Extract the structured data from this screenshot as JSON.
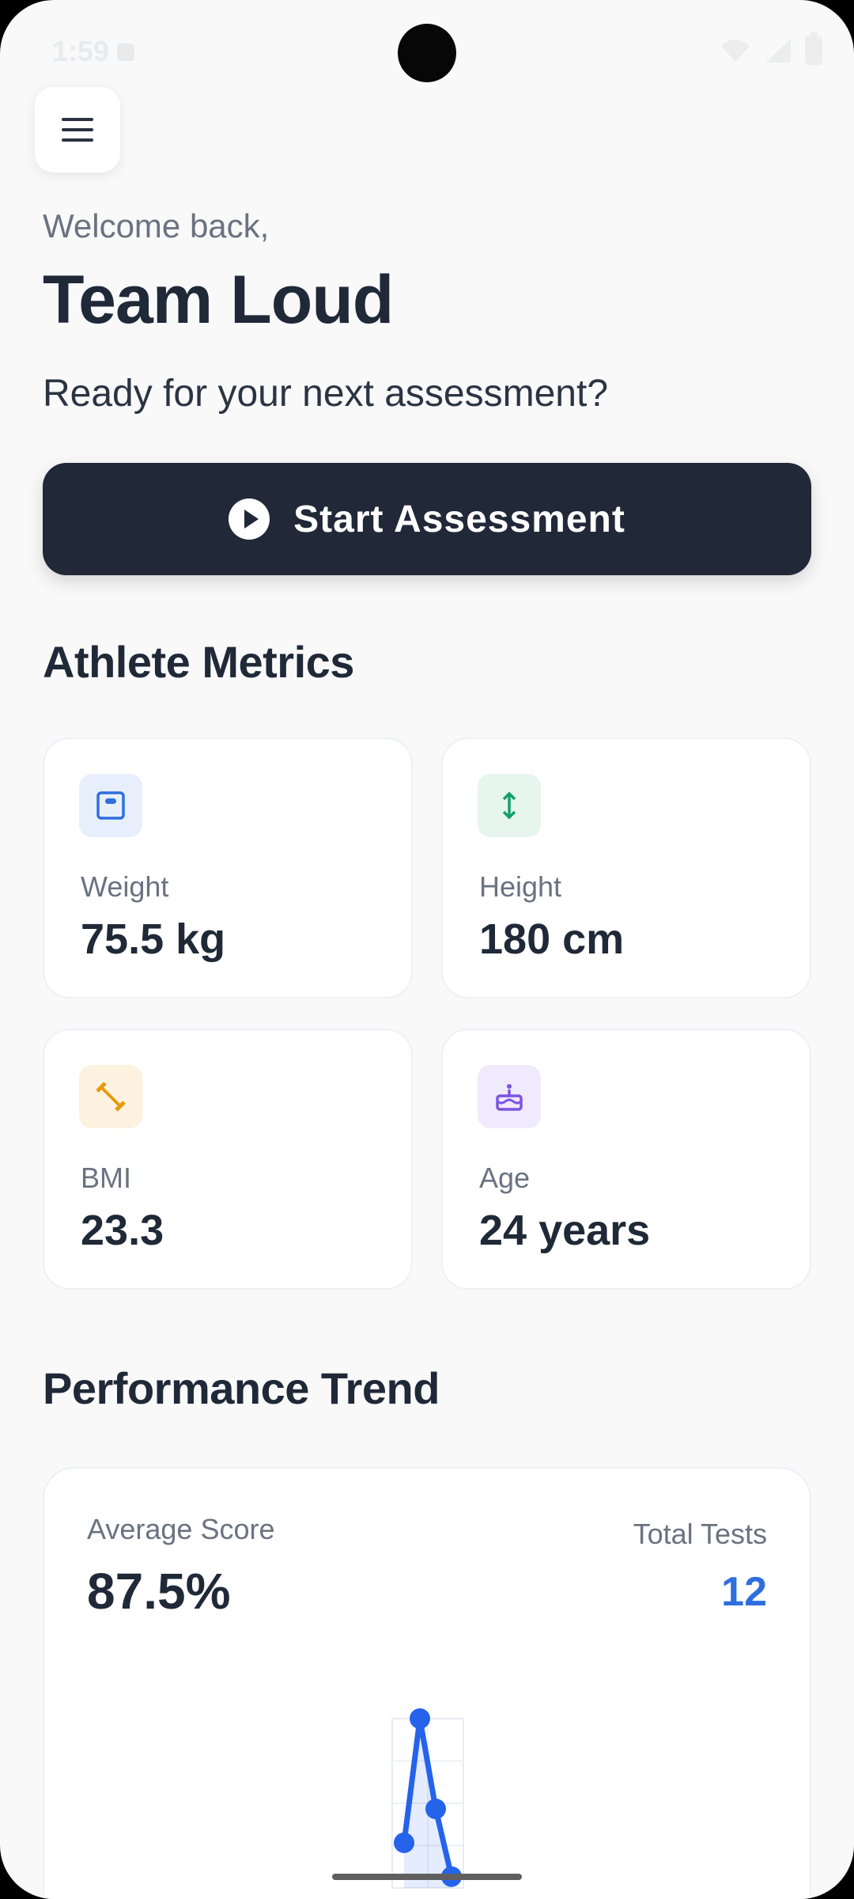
{
  "status_bar": {
    "time": "1:59"
  },
  "menu": {
    "icon": "hamburger-menu-icon"
  },
  "header": {
    "welcome": "Welcome back,",
    "team_name": "Team Loud",
    "subtitle": "Ready for your next assessment?"
  },
  "start_button": {
    "label": "Start Assessment",
    "icon": "play-circle-icon"
  },
  "metrics": {
    "title": "Athlete Metrics",
    "items": [
      {
        "label": "Weight",
        "value": "75.5 kg",
        "icon": "scale-icon",
        "accent": "#2f6fdd",
        "bg": "#e8effc"
      },
      {
        "label": "Height",
        "value": "180 cm",
        "icon": "vertical-arrows-icon",
        "accent": "#14a06b",
        "bg": "#e6f6ef"
      },
      {
        "label": "BMI",
        "value": "23.3",
        "icon": "dumbbell-icon",
        "accent": "#e59a10",
        "bg": "#fdf2df"
      },
      {
        "label": "Age",
        "value": "24 years",
        "icon": "birthday-cake-icon",
        "accent": "#7c54e0",
        "bg": "#efeafc"
      }
    ]
  },
  "performance": {
    "title": "Performance Trend",
    "average_score_label": "Average Score",
    "average_score": "87.5%",
    "total_tests_label": "Total Tests",
    "total_tests": "12",
    "line_color": "#2563eb"
  },
  "chart_data": {
    "type": "line",
    "title": "",
    "xlabel": "",
    "ylabel": "",
    "x": [
      1,
      2,
      3,
      4
    ],
    "series": [
      {
        "values": [
          78,
          100,
          84,
          72
        ]
      }
    ],
    "ylim": [
      70,
      100
    ],
    "grid": true
  }
}
